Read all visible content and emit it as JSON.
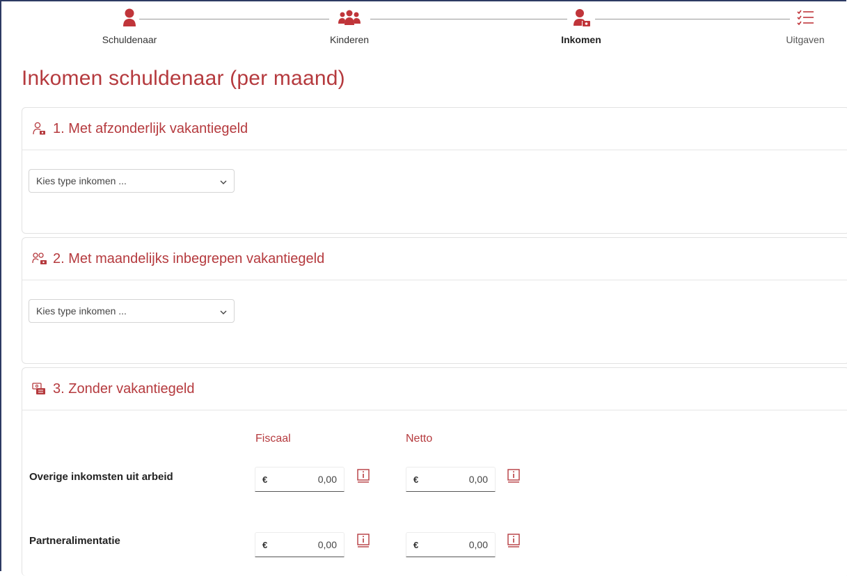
{
  "stepper": {
    "steps": [
      {
        "label": "Schuldenaar",
        "icon": "person-icon"
      },
      {
        "label": "Kinderen",
        "icon": "people-group-icon"
      },
      {
        "label": "Inkomen",
        "icon": "person-money-icon",
        "active": true
      },
      {
        "label": "Uitgaven",
        "icon": "checklist-icon"
      }
    ]
  },
  "page": {
    "title": "Inkomen schuldenaar (per maand)"
  },
  "sections": [
    {
      "title": "1. Met afzonderlijk vakantiegeld",
      "select_placeholder": "Kies type inkomen ..."
    },
    {
      "title": "2. Met maandelijks inbegrepen vakantiegeld",
      "select_placeholder": "Kies type inkomen ..."
    },
    {
      "title": "3. Zonder vakantiegeld"
    }
  ],
  "income_table": {
    "columns": [
      "Fiscaal",
      "Netto"
    ],
    "currency": "€",
    "rows": [
      {
        "label": "Overige inkomsten uit arbeid",
        "fiscaal": "0,00",
        "netto": "0,00"
      },
      {
        "label": "Partneralimentatie",
        "fiscaal": "0,00",
        "netto": "0,00"
      }
    ]
  },
  "colors": {
    "accent": "#b53a3e",
    "border": "#e2e2e2"
  }
}
